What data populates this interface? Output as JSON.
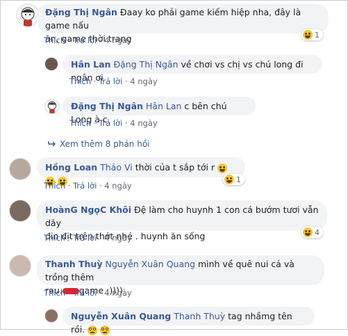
{
  "comments": [
    {
      "author": "Đặng Thị Ngân",
      "text": "Đaay ko phải game kiếm hiệp nha, đây là game nấu ăn, game thời trang",
      "line1": "Đaay ko phải game kiếm hiệp nha, đây là game nấu",
      "line2": "ăn, game thời trang",
      "like": "Thích",
      "reply": "Trả lời",
      "time": "4 ngày",
      "reaction_icon": "laugh-emoji",
      "reaction_count": "1"
    },
    {
      "author": "Hồng Loan",
      "mention": "Thảo Vi",
      "text": "thời của t sắp tới r",
      "like": "Thích",
      "reply": "Trả lời",
      "time": "4 ngày",
      "reaction_icon": "laugh-emoji",
      "reaction_count": "1"
    },
    {
      "author": "HoànG NgọC Khôi",
      "text": "Đệ làm cho huynh 1 con cá bướm tươi vẫn dãy đin địt trên thớt nhé . huynh ăn sống",
      "line1": "Đệ làm cho huynh 1 con cá bướm tươi vẫn dãy",
      "line2": "đin địt trên thớt nhé . huynh ăn sống",
      "like": "Thích",
      "reply": "Trả lời",
      "time": "4 ngày",
      "reaction_icon": "laugh-emoji",
      "reaction_count": "4"
    },
    {
      "author": "Thanh Thuỳ",
      "mention": "Nguyễn Xuân Quang",
      "line1": "mình về quê nui cá và trồng thêm",
      "line2_pre": "rau.",
      "line2_post": "game :))))",
      "like": "Thích",
      "reply": "Trả lời",
      "time": "4 ngày"
    }
  ],
  "replies": [
    {
      "author": "Hân Lan",
      "mention": "Đặng Thị Ngân",
      "text": "về chơi vs chị vs chú long đi ngân ơi",
      "like": "Thích",
      "reply": "Trả lời",
      "time": "4 ngày"
    },
    {
      "author": "Đặng Thị Ngân",
      "mention": "Hân Lan",
      "text": "c bên chú Long à c",
      "like": "Thích",
      "reply": "Trả lời",
      "time": "4 ngày"
    },
    {
      "author": "Nguyễn Xuân Quang",
      "mention": "Thanh Thuỳ",
      "text": "tag nhầmg tên rồi.",
      "reaction_icons": [
        "rolling-eyes-emoji",
        "rolling-eyes-emoji"
      ]
    }
  ],
  "more_replies": "Xem thêm 8 phản hồi",
  "separator": "·"
}
